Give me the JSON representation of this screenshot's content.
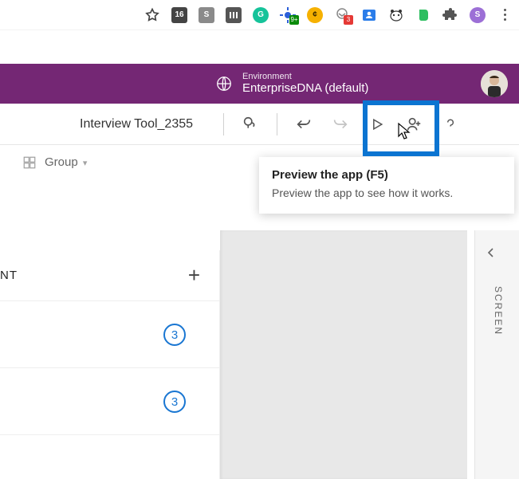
{
  "browser": {
    "star_icon": "star-icon",
    "extensions": [
      {
        "name": "ext-16-icon",
        "label": "16",
        "bg": "#444"
      },
      {
        "name": "skype-icon",
        "label": "S",
        "bg": "#00aff0"
      },
      {
        "name": "ext-bars-icon",
        "label": "",
        "bg": "#555"
      },
      {
        "name": "grammarly-icon",
        "label": "G",
        "bg": "#15c39a"
      },
      {
        "name": "ext-burst-icon",
        "label": "",
        "bg": "#2b5fd9"
      },
      {
        "name": "ext-moon-icon",
        "label": "",
        "bg": "#f6b100"
      },
      {
        "name": "ext-mail-icon",
        "label": "",
        "bg": "#8c8c8c",
        "badge": "3"
      },
      {
        "name": "ext-people-icon",
        "label": "",
        "bg": "#2b7de9"
      },
      {
        "name": "honeybadger-icon",
        "label": "",
        "bg": "#fff"
      },
      {
        "name": "evernote-icon",
        "label": "",
        "bg": "#2dbe60"
      },
      {
        "name": "extensions-puzzle-icon",
        "label": "",
        "bg": "#555"
      },
      {
        "name": "profile-avatar-icon",
        "label": "S",
        "bg": "#9c6fd6"
      }
    ],
    "menu_icon": "menu-dots-icon"
  },
  "banner": {
    "env_label": "Environment",
    "env_name": "EnterpriseDNA (default)"
  },
  "toolbar": {
    "doc_title": "Interview Tool_2355"
  },
  "groupbar": {
    "label": "Group"
  },
  "tooltip": {
    "title": "Preview the app (F5)",
    "body": "Preview the app to see how it works."
  },
  "left_panel": {
    "header_suffix": "NT",
    "add_label": "+",
    "items": [
      {
        "badge": "3"
      },
      {
        "badge": "3"
      }
    ]
  },
  "right_rail": {
    "label": "SCREEN"
  },
  "badges": {
    "ext_green": "9+"
  }
}
